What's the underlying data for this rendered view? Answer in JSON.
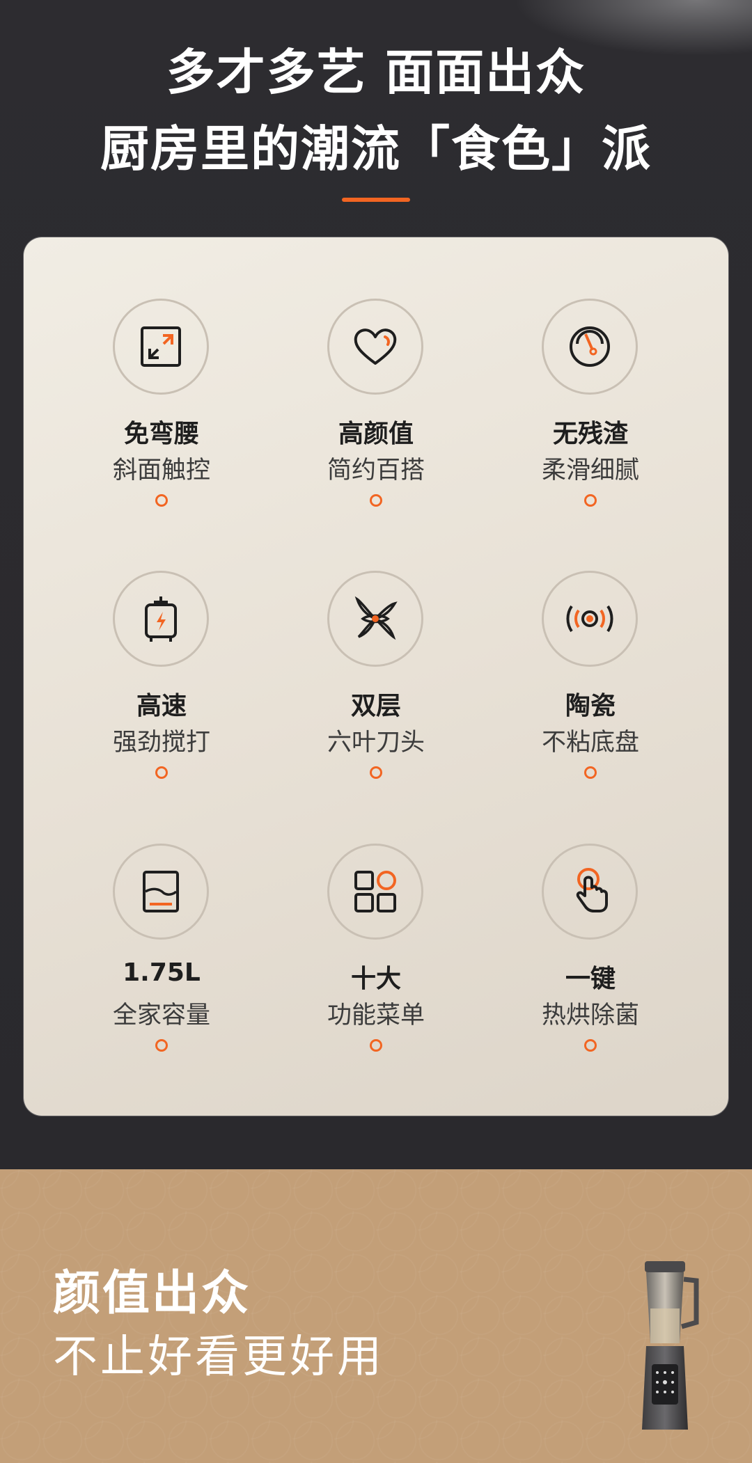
{
  "header": {
    "line1": "多才多艺 面面出众",
    "line2": "厨房里的潮流「食色」派"
  },
  "features": [
    {
      "icon": "diagonal-arrows-icon",
      "title": "免弯腰",
      "subtitle": "斜面触控"
    },
    {
      "icon": "heart-icon",
      "title": "高颜值",
      "subtitle": "简约百搭"
    },
    {
      "icon": "gauge-icon",
      "title": "无残渣",
      "subtitle": "柔滑细腻"
    },
    {
      "icon": "motor-lightning-icon",
      "title": "高速",
      "subtitle": "强劲搅打"
    },
    {
      "icon": "blade-icon",
      "title": "双层",
      "subtitle": "六叶刀头"
    },
    {
      "icon": "ceramic-disc-icon",
      "title": "陶瓷",
      "subtitle": "不粘底盘"
    },
    {
      "icon": "capacity-icon",
      "title": "1.75L",
      "subtitle": "全家容量"
    },
    {
      "icon": "menu-grid-icon",
      "title": "十大",
      "subtitle": "功能菜单"
    },
    {
      "icon": "touch-finger-icon",
      "title": "一键",
      "subtitle": "热烘除菌"
    }
  ],
  "footer": {
    "title": "颜值出众",
    "subtitle": "不止好看更好用"
  },
  "colors": {
    "accent": "#f26522",
    "dark_bg": "#2b2a2e",
    "card_bg": "#ece7dd",
    "bottom_bg": "#c39f78"
  }
}
